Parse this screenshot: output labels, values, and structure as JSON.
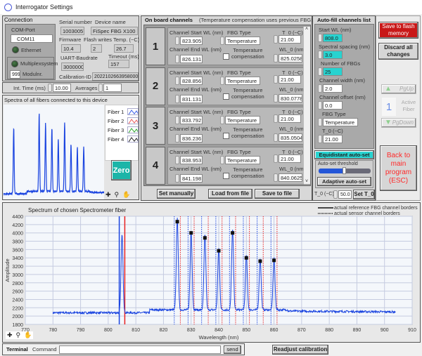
{
  "window": {
    "title": "Interrogator Settings"
  },
  "connection": {
    "title": "Connection",
    "com_port_label": "COM-Port",
    "com_port_value": "COM11",
    "ethernet_label": "Ethernet",
    "multiplex_label": "Multiplexsystem",
    "modul_value": "999",
    "modul_label": "Modulnr.",
    "serial_label": "Serial number",
    "serial_value": "10030057",
    "device_label": "Device name",
    "device_value": "FiSpec FBG X100",
    "firmware_label": "Firmware",
    "firmware_value": "10.4",
    "flash_label": "Flash writes",
    "flash_value": "2",
    "temp_label": "Temp. (~C)",
    "temp_value": "26.7",
    "uart_label": "UART-Baudrate",
    "uart_value": "3000000",
    "timeout_label": "Timeout (ms)",
    "timeout_value": "157",
    "calib_label": "Calibration-ID",
    "calib_value": "20221026639580001"
  },
  "acquisition": {
    "int_time_label": "Int. Time (ms)",
    "int_time_value": "10.00",
    "averages_label": "Averages",
    "averages_value": "1"
  },
  "small_chart": {
    "title": "Spectra of all fibers connected to this device",
    "legend": [
      "Fiber 1",
      "Fiber 2",
      "Fiber 3",
      "Fiber 4"
    ],
    "legend_colors": [
      "#3a5ee8",
      "#e85a5a",
      "#2aa52a",
      "#222222"
    ],
    "zero_label": "Zero"
  },
  "channels": {
    "title": "On board channels",
    "note": "(Temperature compensation uses previous FBG!)",
    "start_label": "Channel Start WL (nm)",
    "end_label": "Channel End WL (nm)",
    "type_label": "FBG Type",
    "t0_label": "T_0 (~C)",
    "wl0_label": "WL_0  (nm)",
    "comp_label_1": "Temperature",
    "comp_label_2": "compensation",
    "rows": [
      {
        "num": "1",
        "start": "823.905",
        "end": "826.131",
        "type": "Temperature",
        "t0": "21.00",
        "wl0": "825.0258",
        "comp": false
      },
      {
        "num": "2",
        "start": "828.856",
        "end": "831.131",
        "type": "Temperature",
        "t0": "21.00",
        "wl0": "830.0778",
        "comp": false
      },
      {
        "num": "3",
        "start": "833.792",
        "end": "836.236",
        "type": "Temperature",
        "t0": "21.00",
        "wl0": "835.0504",
        "comp": false
      },
      {
        "num": "4",
        "start": "838.953",
        "end": "841.198",
        "type": "Temperature",
        "t0": "21.00",
        "wl0": "840.0625",
        "comp": false
      }
    ],
    "set_manually": "Set manually",
    "load_file": "Load from file",
    "save_file": "Save to file"
  },
  "autofill": {
    "title": "Auto-fill channels list",
    "start_label": "Start WL (nm)",
    "start_value": "808.0",
    "spacing_label": "Spectral spacing (nm)",
    "spacing_value": "3.0",
    "count_label": "Number of FBGs",
    "count_value": "25",
    "width_label": "Channel width (nm)",
    "width_value": "2.0",
    "offset_label": "Channel offset (nm)",
    "offset_value": "0.0",
    "type_label": "FBG Type",
    "type_value": "Temperature",
    "t0_label": "T_0 (~C)",
    "t0_value": "21.00",
    "equidistant": "Equidistant auto-set",
    "threshold_label": "Auto-set threshold",
    "threshold_level": 0.5,
    "adaptive": "Adaptive auto-set",
    "set_t0_label": "T_0 (~C)",
    "set_t0_value": "50.0",
    "set_t0_button": "Set T_0"
  },
  "actions": {
    "save_flash": "Save to flash memory",
    "discard": "Discard all changes",
    "pgup": "PgUp",
    "active_fiber_value": "1",
    "active_fiber_label": "Active Fiber",
    "pgdown": "PgDown",
    "back": "Back to main program (ESC)"
  },
  "terminal": {
    "tab": "Terminal",
    "command_label": "Command",
    "command_value": "",
    "send": "send",
    "readjust": "Readjust calibration"
  },
  "colors": {
    "accent_cyan": "#27d3d0",
    "save_red": "#c81818",
    "back_text": "#ff2a2a",
    "spectrum": "#1a44e0",
    "sensor_border_start": "#1a44e0",
    "sensor_border_end": "#e82020"
  },
  "chart_data": {
    "type": "line",
    "title": "Spectrum of chosen Spectrometer fiber",
    "xlabel": "Wavelength (nm)",
    "ylabel": "Amplitude",
    "xlim": [
      770,
      910
    ],
    "ylim": [
      1800,
      4400
    ],
    "xticks": [
      770,
      780,
      790,
      800,
      810,
      820,
      830,
      840,
      850,
      860,
      870,
      880,
      890,
      900,
      910
    ],
    "yticks": [
      1800,
      2000,
      2200,
      2400,
      2600,
      2800,
      3000,
      3200,
      3400,
      3600,
      3800,
      4000,
      4200,
      4400
    ],
    "grid": true,
    "legend": [
      "actual reference FBG channel borders",
      "actual sensor channel borders"
    ],
    "legend_placement": "top-right",
    "spectrum_range": [
      780,
      904
    ],
    "baseline": 2080,
    "peaks": [
      {
        "x": 805.0,
        "y": 3950
      },
      {
        "x": 825.0,
        "y": 4270
      },
      {
        "x": 830.0,
        "y": 4000
      },
      {
        "x": 835.0,
        "y": 3880
      },
      {
        "x": 840.0,
        "y": 3570
      },
      {
        "x": 845.0,
        "y": 4000
      },
      {
        "x": 850.0,
        "y": 3400
      },
      {
        "x": 855.0,
        "y": 3320
      },
      {
        "x": 860.0,
        "y": 3340
      }
    ],
    "peak_markers": [
      [
        825.0,
        4270
      ],
      [
        830.0,
        4000
      ],
      [
        835.0,
        3880
      ],
      [
        840.0,
        3570
      ],
      [
        845.0,
        4000
      ],
      [
        850.0,
        3400
      ],
      [
        855.0,
        3320
      ],
      [
        860.0,
        3340
      ]
    ],
    "reference_borders": [
      804.0,
      806.0
    ],
    "sensor_borders": [
      [
        823.9,
        826.1
      ],
      [
        828.9,
        831.1
      ],
      [
        833.8,
        836.2
      ],
      [
        838.95,
        841.2
      ],
      [
        843.9,
        846.1
      ],
      [
        848.9,
        851.1
      ],
      [
        853.9,
        856.1
      ],
      [
        858.9,
        861.1
      ]
    ]
  }
}
